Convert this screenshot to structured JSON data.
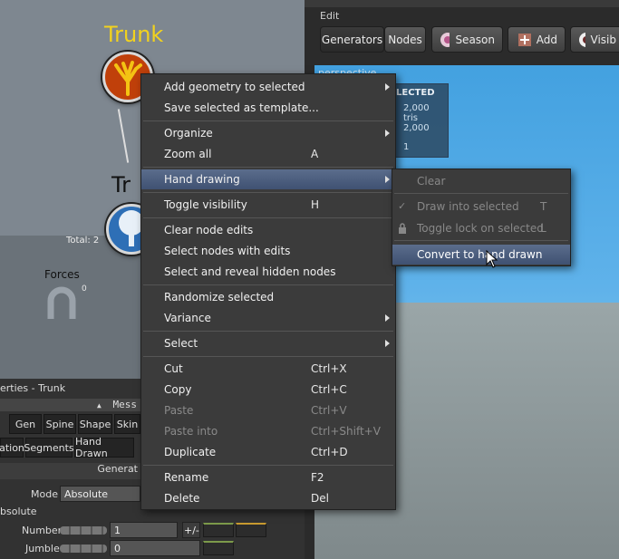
{
  "graph": {
    "node_top_title": "Trunk",
    "node_bottom_title": "Tr",
    "total_label": "Total: 2",
    "forces_label": "Forces",
    "forces_value": "0"
  },
  "toolbar": {
    "edit_label": "Edit",
    "generators": "Generators",
    "nodes": "Nodes",
    "season": "Season",
    "add": "Add",
    "visibility": "Visib"
  },
  "viewport": {
    "label": "perspective",
    "stats_header": "LECTED",
    "stats_line1": "2,000 tris",
    "stats_line2": "2,000",
    "stats_line3": "1"
  },
  "properties": {
    "title": "erties - Trunk",
    "mess_label": "Mess",
    "tabs_row1": [
      "Gen",
      "Spine",
      "Shape",
      "Skin"
    ],
    "tabs_row2": [
      "ation",
      "Segments",
      "Hand Drawn"
    ],
    "section_header": "Generat",
    "mode_label": "Mode",
    "mode_value": "Absolute",
    "absolute_label": "bsolute",
    "number_label": "Number",
    "number_value": "1",
    "plusminus": "+/-",
    "jumble_label": "Jumble",
    "jumble_value": "0"
  },
  "context_menu": {
    "items": [
      {
        "label": "Add geometry to selected",
        "shortcut": ""
      },
      {
        "label": "Save selected as template...",
        "shortcut": ""
      },
      {
        "label": "Organize",
        "shortcut": ""
      },
      {
        "label": "Zoom all",
        "shortcut": "A"
      },
      {
        "label": "Hand drawing",
        "shortcut": ""
      },
      {
        "label": "Toggle visibility",
        "shortcut": "H"
      },
      {
        "label": "Clear node edits",
        "shortcut": ""
      },
      {
        "label": "Select nodes with edits",
        "shortcut": ""
      },
      {
        "label": "Select and reveal hidden nodes",
        "shortcut": ""
      },
      {
        "label": "Randomize selected",
        "shortcut": ""
      },
      {
        "label": "Variance",
        "shortcut": ""
      },
      {
        "label": "Select",
        "shortcut": ""
      },
      {
        "label": "Cut",
        "shortcut": "Ctrl+X"
      },
      {
        "label": "Copy",
        "shortcut": "Ctrl+C"
      },
      {
        "label": "Paste",
        "shortcut": "Ctrl+V"
      },
      {
        "label": "Paste into",
        "shortcut": "Ctrl+Shift+V"
      },
      {
        "label": "Duplicate",
        "shortcut": "Ctrl+D"
      },
      {
        "label": "Rename",
        "shortcut": "F2"
      },
      {
        "label": "Delete",
        "shortcut": "Del"
      }
    ]
  },
  "submenu": {
    "items": [
      {
        "label": "Clear",
        "shortcut": ""
      },
      {
        "label": "Draw into selected",
        "shortcut": "T"
      },
      {
        "label": "Toggle lock on selected",
        "shortcut": "L"
      },
      {
        "label": "Convert to hand drawn",
        "shortcut": ""
      }
    ]
  },
  "colors": {
    "accent_highlight": "#4a5d80",
    "trunk_title": "#f2d21e",
    "node_top_fill": "#c0400a",
    "node_bottom_fill": "#2e6fb6"
  }
}
